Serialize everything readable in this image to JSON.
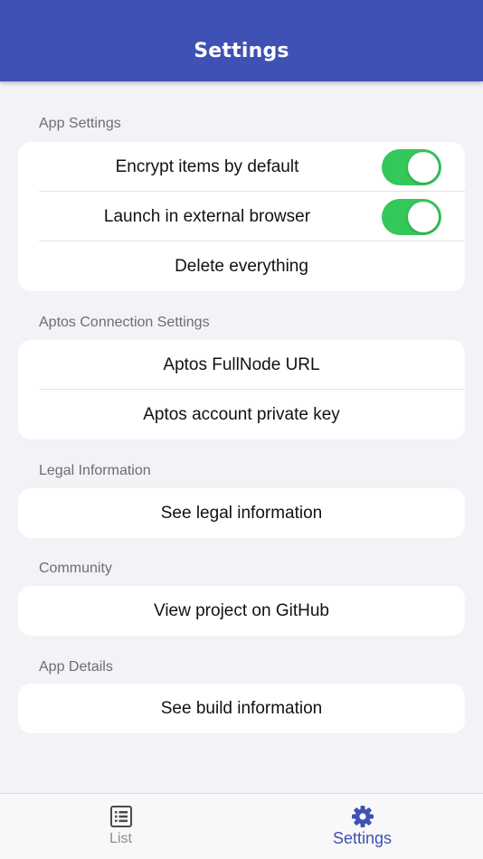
{
  "header": {
    "title": "Settings"
  },
  "colors": {
    "header_bg": "#3f51b5",
    "toggle_on": "#34c759",
    "tab_active": "#3f51b5",
    "tab_inactive": "#8e8e93"
  },
  "sections": {
    "app_settings": {
      "label": "App Settings",
      "encrypt": {
        "label": "Encrypt items by default",
        "enabled": true
      },
      "external_browser": {
        "label": "Launch in external browser",
        "enabled": true
      },
      "delete": {
        "label": "Delete everything"
      }
    },
    "aptos": {
      "label": "Aptos Connection Settings",
      "fullnode": {
        "label": "Aptos FullNode URL"
      },
      "private_key": {
        "label": "Aptos account private key"
      }
    },
    "legal": {
      "label": "Legal Information",
      "see_legal": {
        "label": "See legal information"
      }
    },
    "community": {
      "label": "Community",
      "github": {
        "label": "View project on GitHub"
      }
    },
    "details": {
      "label": "App Details",
      "build": {
        "label": "See build information"
      }
    }
  },
  "tabbar": {
    "list": {
      "label": "List",
      "icon": "list-icon",
      "active": false
    },
    "settings": {
      "label": "Settings",
      "icon": "gear-icon",
      "active": true
    }
  }
}
